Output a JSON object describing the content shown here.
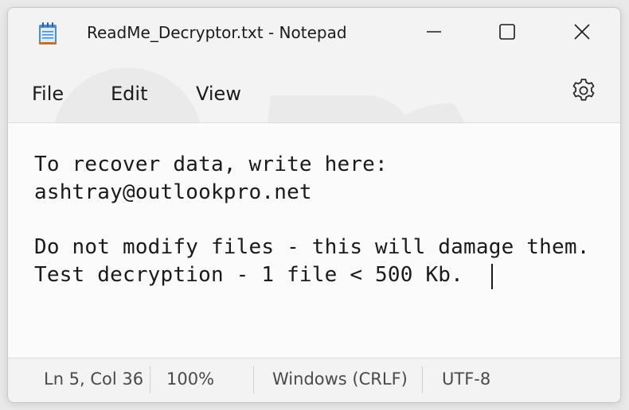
{
  "window": {
    "title": "ReadMe_Decryptor.txt - Notepad",
    "icon": "notepad-icon"
  },
  "controls": {
    "minimize": "minimize-icon",
    "maximize": "maximize-icon",
    "close": "close-icon"
  },
  "menu": {
    "items": [
      "File",
      "Edit",
      "View"
    ],
    "settings_icon": "gear-icon"
  },
  "editor": {
    "lines": [
      "To recover data, write here:",
      "ashtray@outlookpro.net",
      "",
      "Do not modify files - this will damage them.",
      "Test decryption - 1 file < 500 Kb. "
    ]
  },
  "status": {
    "position": "Ln 5, Col 36",
    "zoom": "100%",
    "line_endings": "Windows (CRLF)",
    "encoding": "UTF-8"
  },
  "colors": {
    "chrome": "#f3f3f3",
    "editor_bg": "#fbfbfb",
    "text": "#1a1a1a"
  }
}
